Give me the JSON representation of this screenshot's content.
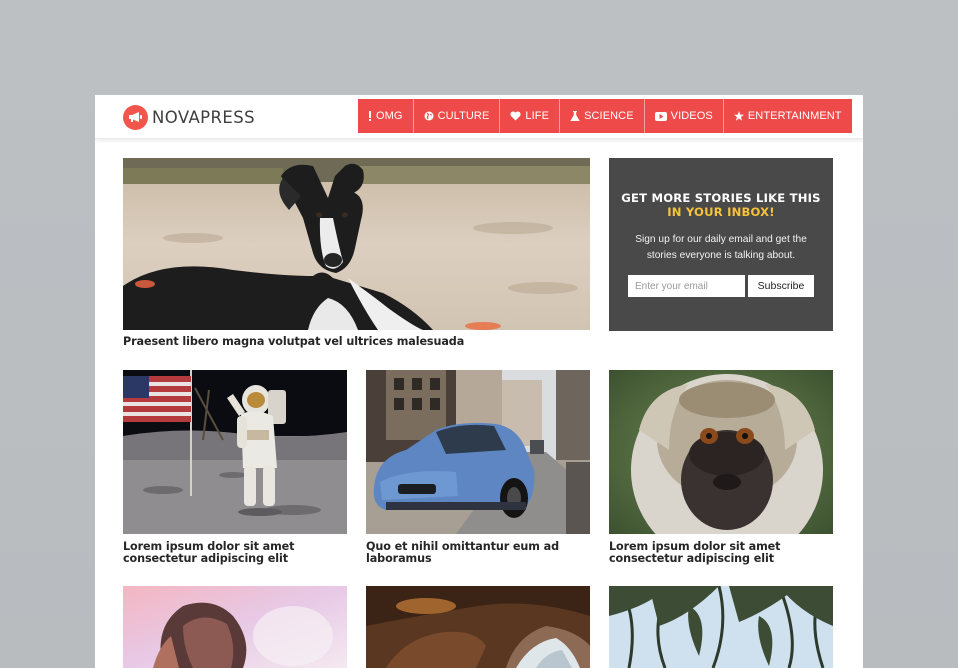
{
  "site": {
    "logo_text": "NOVAPRESS"
  },
  "nav": {
    "items": [
      {
        "label": "OMG",
        "icon": "exclamation-icon"
      },
      {
        "label": "CULTURE",
        "icon": "globe-icon"
      },
      {
        "label": "LIFE",
        "icon": "heart-icon"
      },
      {
        "label": "SCIENCE",
        "icon": "flask-icon"
      },
      {
        "label": "VIDEOS",
        "icon": "video-icon"
      },
      {
        "label": "ENTERTAINMENT",
        "icon": "star-icon"
      }
    ]
  },
  "featured": {
    "caption": "Praesent libero magna volutpat vel ultrices malesuada"
  },
  "newsletter": {
    "title_line1": "GET MORE STORIES LIKE THIS",
    "title_line2": "IN YOUR INBOX!",
    "description": "Sign up for our daily email and get the stories everyone is talking about.",
    "email_placeholder": "Enter your email",
    "subscribe_label": "Subscribe"
  },
  "articles": [
    {
      "caption": "Lorem ipsum dolor sit amet consectetur adipiscing elit"
    },
    {
      "caption": "Quo et nihil omittantur eum ad laboramus"
    },
    {
      "caption": "Lorem ipsum dolor sit amet consectetur adipiscing elit"
    }
  ],
  "colors": {
    "accent": "#ef4a4a",
    "promo_bg": "#494949",
    "promo_highlight": "#f7c23c"
  }
}
